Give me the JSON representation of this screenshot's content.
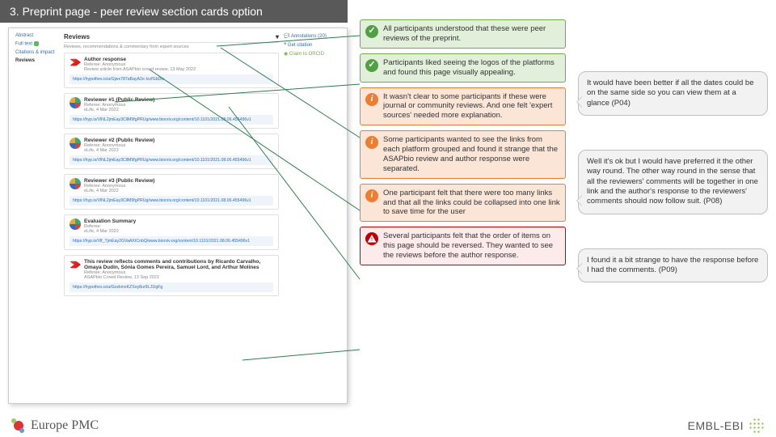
{
  "title": "3. Preprint page - peer review section cards option",
  "screenshot": {
    "nav": {
      "abstract": "Abstract",
      "fulltext": "Full text",
      "citations": "Citations & impact",
      "reviews": "Reviews"
    },
    "heading": "Reviews",
    "subheading": "Reviews, recommendations & commentary from expert sources",
    "side": {
      "annotations": "Annotations (20)",
      "getcite": "Get citation",
      "orcid": "Claim to ORCID"
    },
    "cards": [
      {
        "logo": "asap",
        "title": "Author response",
        "meta": "Referee: Anonymous",
        "meta2": "Review article from ASAPbio crowd review, 13 May 2022",
        "link": "https://hypothes.is/a/Gjwx787aBayA2e-IzzfGbDw"
      },
      {
        "logo": "elife",
        "title": "Reviewer #1 (Public Review)",
        "meta": "Referee: Anonymous",
        "meta2": "eLife, 4 Mar 2022",
        "link": "https://hyp.is/VlNL2jmEay3CllM9fgPRUg/www.biorxiv.org/content/10.1101/2021.08.06.455496v1"
      },
      {
        "logo": "elife",
        "title": "Reviewer #2 (Public Review)",
        "meta": "Referee: Anonymous",
        "meta2": "eLife, 4 Mar 2022",
        "link": "https://hyp.is/VlNL2jmEay3CllM9fgPRUg/www.biorxiv.org/content/10.1101/2021.08.06.455496v1"
      },
      {
        "logo": "elife",
        "title": "Reviewer #3 (Public Review)",
        "meta": "Referee: Anonymous",
        "meta2": "eLife, 4 Mar 2022",
        "link": "https://hyp.is/VlNL2jmEay3CllM9fgPRUg/www.biorxiv.org/content/10.1101/2021.08.06.455496v1"
      },
      {
        "logo": "elife",
        "title": "Evaluation Summary",
        "meta": "Referee:",
        "meta2": "eLife, 4 Mar 2022",
        "link": "https://hyp.is/Vlf_TjmEay2GVaAXtCnbQ/www.biorxiv.org/content/10.1101/2021.08.06.455496v1"
      },
      {
        "logo": "asap",
        "title": "This review reflects comments and contributions by Ricardo Carvalho, Omaya Dudin, Sónia Gomes Pereira, Samuel Lord, and Arthur Molines",
        "meta": "Referee: Anonymous",
        "meta2": "ASAPbio Crowd Review, 13 Sep 2021",
        "link": "https://hypothes.is/a/GozkmxKZSoy8ur9LJ1IgFg"
      }
    ]
  },
  "findings": [
    {
      "type": "good",
      "text": "All participants understood that these were peer reviews of the preprint."
    },
    {
      "type": "good",
      "text": "Participants liked seeing the logos of the platforms and found this page visually appealing."
    },
    {
      "type": "warn",
      "text": "It wasn't clear to some participants if these were journal or community reviews. And one felt 'expert sources' needed more explanation."
    },
    {
      "type": "warn",
      "text": "Some participants wanted to see the links from each platform grouped and found it strange that the ASAPbio review and author response were separated."
    },
    {
      "type": "warn",
      "text": "One participant felt that there were too many links and that all the links could be collapsed into one link to save time for the user"
    },
    {
      "type": "bad",
      "text": "Several participants felt that the order of items on this page should be reversed. They wanted to see the reviews before the author response."
    }
  ],
  "quotes": [
    "It would have been better if all the dates could be on the same side so you can view them at a glance (P04)",
    "Well it's ok but I would have preferred it the other way round. The other way round in the sense that all the reviewers' comments will be together in one link and the author's response to the reviewers' comments should now follow suit. (P08)",
    "I found it a bit strange to have the response before I had the comments. (P09)"
  ],
  "footer": {
    "epmc": "Europe PMC",
    "ebi": "EMBL-EBI"
  }
}
